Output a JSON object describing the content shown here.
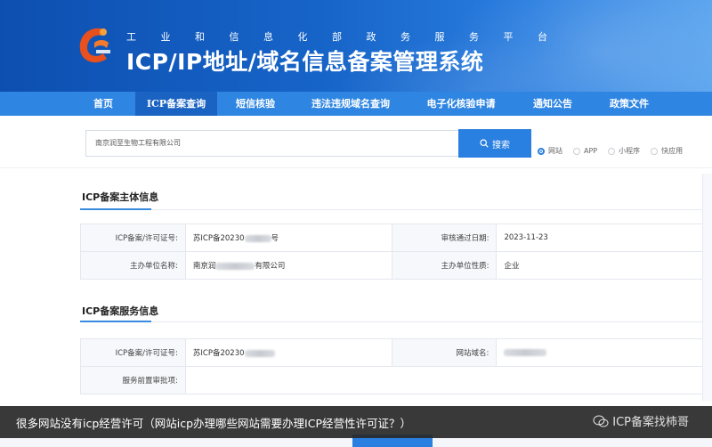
{
  "header": {
    "subtitle": "工 业 和 信 息 化 部 政 务 服 务 平 台",
    "title": "ICP/IP地址/域名信息备案管理系统",
    "colors": {
      "banner_dark": "#0d4fb0",
      "banner_light": "#5aa4ee",
      "nav": "#2f86e2",
      "nav_active": "#1a63c2"
    }
  },
  "nav": {
    "items": [
      {
        "label": "首页",
        "active": false
      },
      {
        "label": "ICP备案查询",
        "active": true
      },
      {
        "label": "短信核验",
        "active": false
      },
      {
        "label": "违法违规域名查询",
        "active": false
      },
      {
        "label": "电子化核验申请",
        "active": false
      },
      {
        "label": "通知公告",
        "active": false
      },
      {
        "label": "政策文件",
        "active": false
      }
    ]
  },
  "search": {
    "value": "南京润至生物工程有限公司",
    "button_label": "搜索",
    "button_icon": "search-icon",
    "options": [
      {
        "label": "网站",
        "checked": true
      },
      {
        "label": "APP",
        "checked": false
      },
      {
        "label": "小程序",
        "checked": false
      },
      {
        "label": "快应用",
        "checked": false
      }
    ]
  },
  "subject_section": {
    "title": "ICP备案主体信息",
    "rows": [
      {
        "label1": "ICP备案/许可证号:",
        "value1": "苏ICP备20230",
        "value1_suffix": "号",
        "label2": "审核通过日期:",
        "value2": "2023-11-23"
      },
      {
        "label1": "主办单位名称:",
        "value1": "南京润",
        "value1_suffix": "有限公司",
        "label2": "主办单位性质:",
        "value2": "企业"
      }
    ]
  },
  "service_section": {
    "title": "ICP备案服务信息",
    "rows": [
      {
        "label1": "ICP备案/许可证号:",
        "value1": "苏ICP备20230",
        "label2": "网站域名:",
        "value2": ""
      },
      {
        "label1": "服务前置审批项:",
        "value1": ""
      }
    ]
  },
  "caption": {
    "text": "很多网站没有icp经营许可（网站icp办理哪些网站需要办理ICP经营性许可证？）",
    "watermark": "ICP备案找柿哥",
    "watermark_icon": "wechat-icon"
  }
}
